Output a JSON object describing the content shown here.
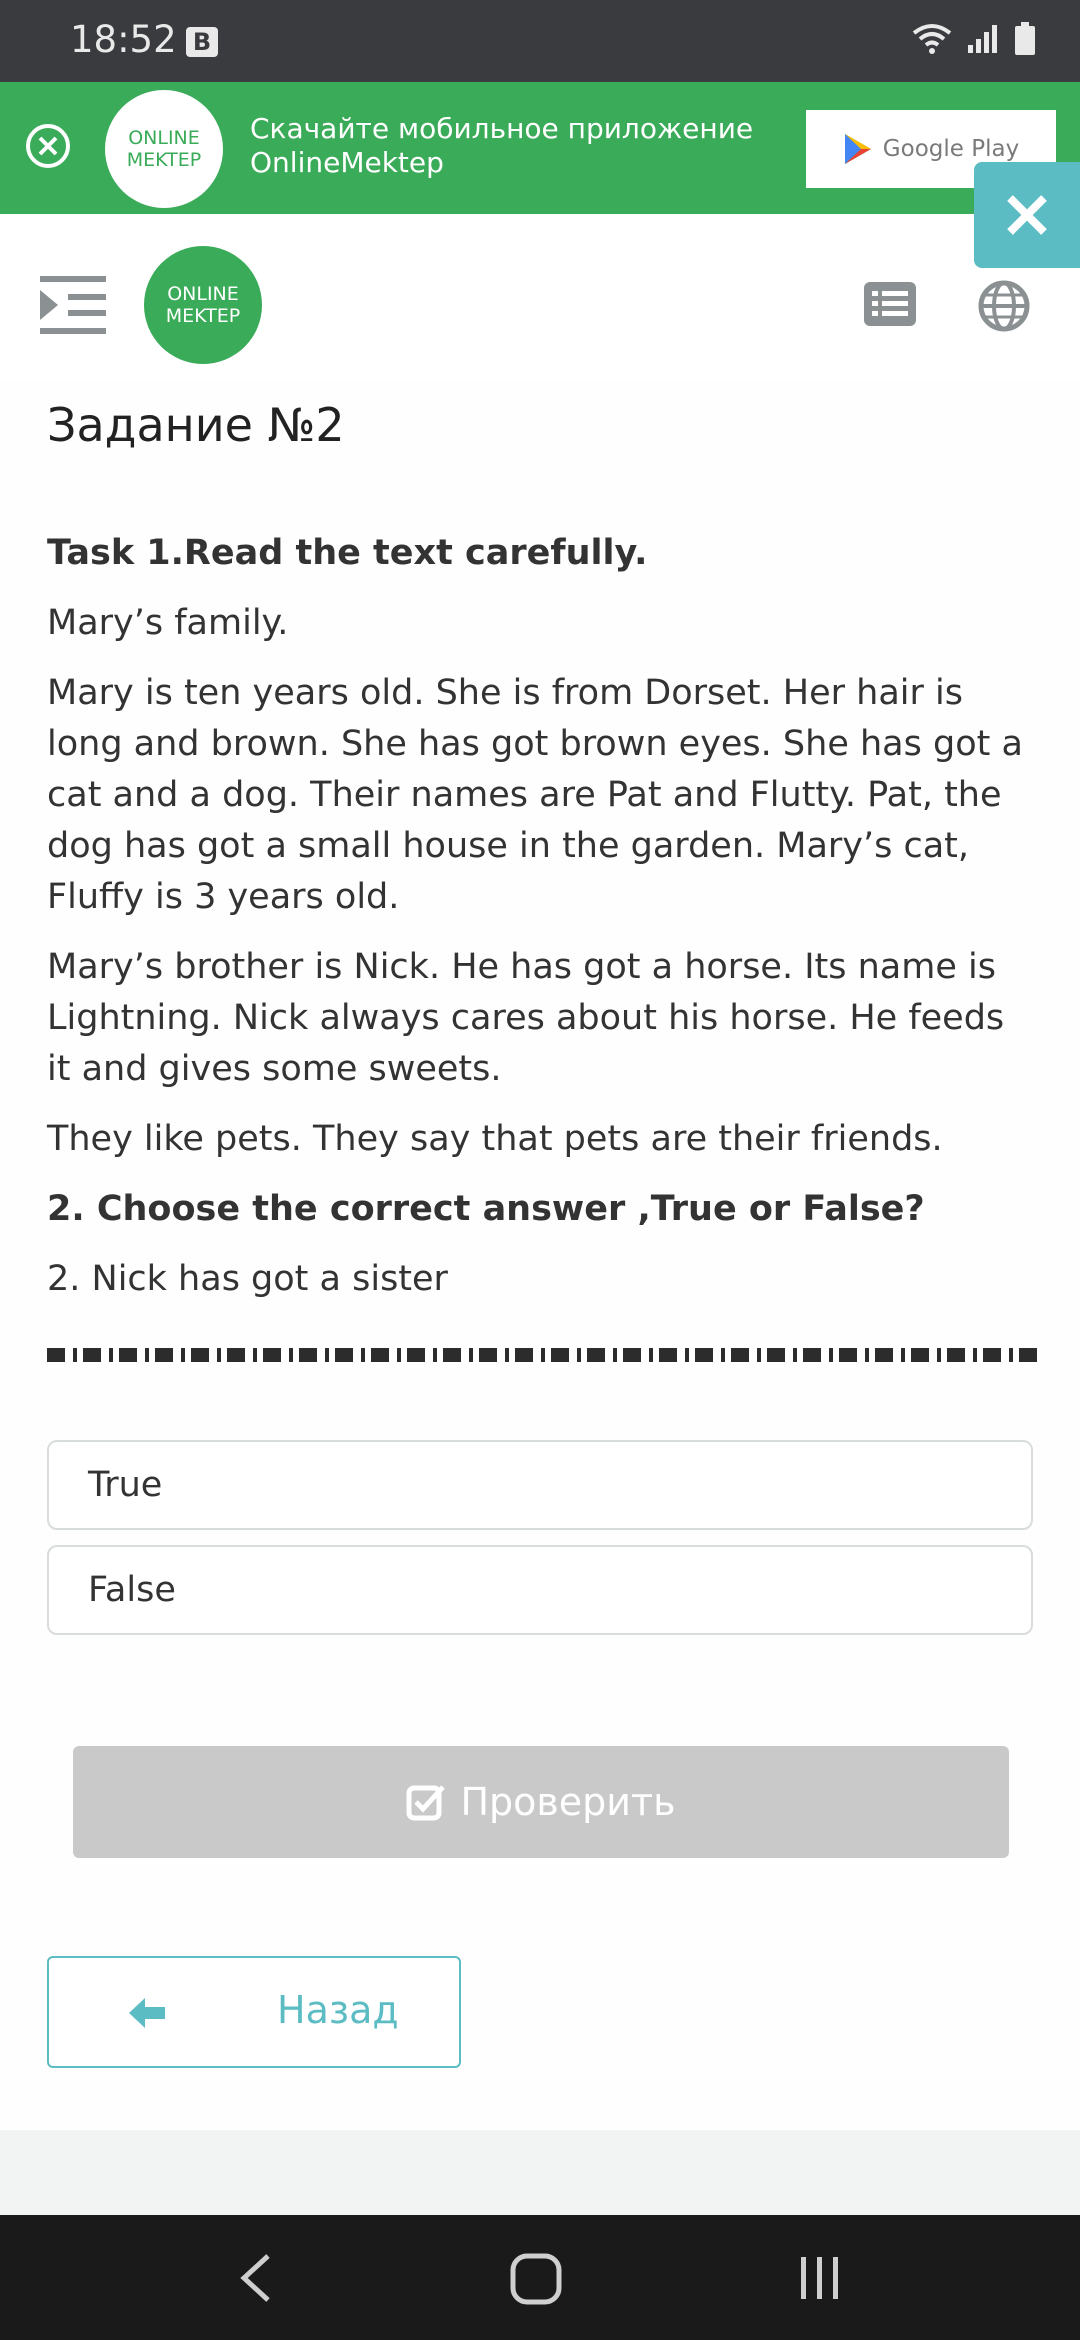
{
  "status_bar": {
    "time": "18:52",
    "badge": "B"
  },
  "banner": {
    "logo_line1": "ONLINE",
    "logo_line2": "MEKTEP",
    "text_line1": "Скачайте мобильное приложение",
    "text_line2": "OnlineMektep",
    "store_label": "Google Play"
  },
  "header": {
    "logo_line1": "ONLINE",
    "logo_line2": "MEKTEP"
  },
  "page": {
    "title": "Задание №2",
    "task_heading": "Task 1.Read the text carefully.",
    "story_title": "Mary’s family.",
    "paragraph1": "Mary is ten years old. She is from Dorset. Her hair is long and brown. She has got brown eyes. She has got a cat and a dog. Their names are Pat and Flutty. Pat, the dog has got a small house in the garden. Mary’s cat, Fluffy is 3 years old.",
    "paragraph2": "Mary’s brother is Nick. He has got a horse. Its name is Lightning. Nick always cares about his horse. He feeds it and gives some sweets.",
    "paragraph3": "They like pets. They say that pets are their friends.",
    "question_heading": "2. Choose the correct answer ,True or False?",
    "statement": "2. Nick has got a sister",
    "options": [
      "True",
      "False"
    ],
    "check_label": "Проверить",
    "back_label": "Назад"
  },
  "colors": {
    "green": "#3aab58",
    "teal": "#5bbcc3",
    "disabled": "#c9c9c9"
  }
}
